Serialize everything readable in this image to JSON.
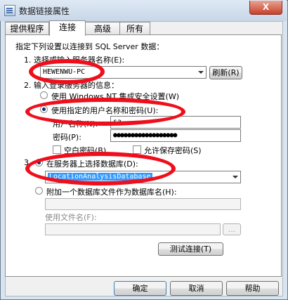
{
  "window": {
    "title": "数据链接属性",
    "close_label": "X"
  },
  "tabs": [
    "提供程序",
    "连接",
    "高级",
    "所有"
  ],
  "instructions": "指定下列设置以连接到 SQL Server 数据：",
  "step1": {
    "label": "1. 选择或输入服务器名称(E):",
    "server_value": "HEWENWU-PC",
    "refresh_button": "刷新(R)"
  },
  "step2": {
    "label": "2. 输入登录服务器的信息：",
    "option_windows": "使用 Windows NT 集成安全设置(W)",
    "option_sql": "使用指定的用户名称和密码(U):",
    "username_label": "用户名称(N):",
    "username_value": "sa",
    "password_label": "密码(P):",
    "password_value": "●●●●●●●●●●●●●●●●●●",
    "blank_password": "空白密码(B)",
    "allow_save": "允许保存密码(S)"
  },
  "step3": {
    "label": "3.",
    "option_select_db": "在服务器上选择数据库(D):",
    "database_value": "LocationAnalysisDatabase",
    "option_attach": "附加一个数据库文件作为数据库名(H):",
    "use_file_label": "使用文件名(F):",
    "browse_button": "..."
  },
  "test_button": "测试连接(T)",
  "footer": {
    "ok": "确定",
    "cancel": "取消",
    "help": "帮助"
  }
}
